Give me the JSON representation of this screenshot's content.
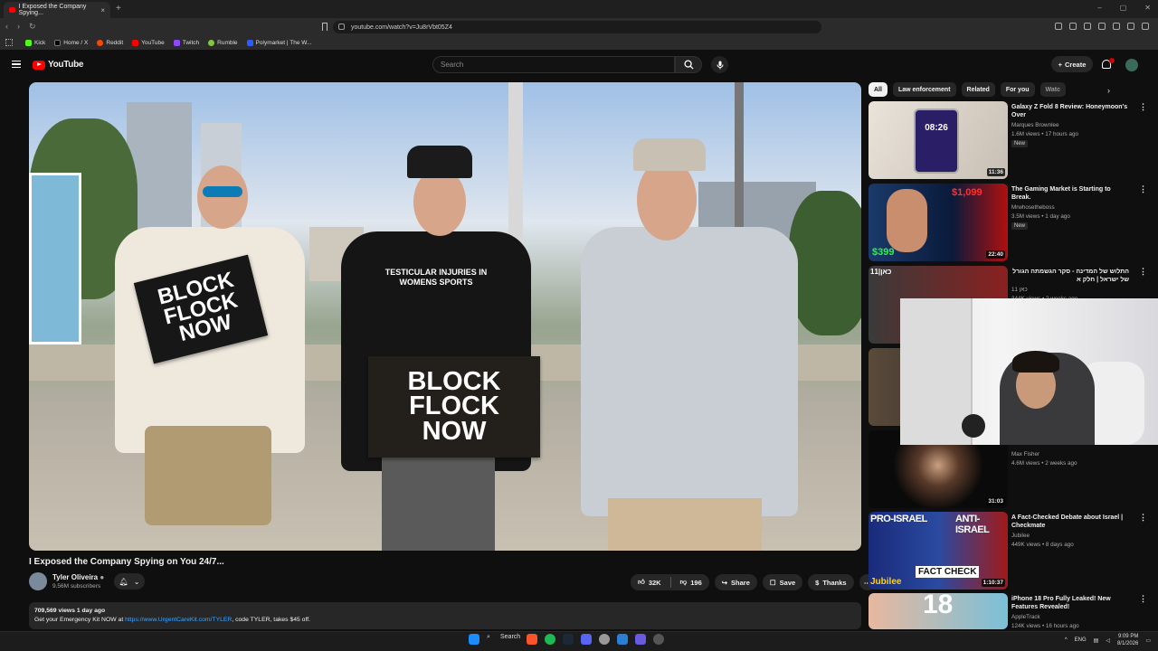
{
  "browser": {
    "tab_title": "I Exposed the Company Spying...",
    "url": "youtube.com/watch?v=Ju8rVbt05Z4",
    "bookmarks": [
      "Kick",
      "Home / X",
      "Reddit",
      "YouTube",
      "Twitch",
      "Rumble",
      "Polymarket | The W..."
    ]
  },
  "youtube": {
    "logo": "YouTube",
    "search_placeholder": "Search",
    "create_label": "Create",
    "notification_count": "1"
  },
  "video": {
    "sign_text": [
      "BLOCK",
      "FLOCK",
      "NOW"
    ],
    "shirt_text": "TESTICULAR INJURIES IN WOMENS SPORTS",
    "title": "I Exposed the Company Spying on You 24/7...",
    "channel": "Tyler Oliveira",
    "subscribers": "9.56M subscribers",
    "likes": "32K",
    "dislikes": "196",
    "share_label": "Share",
    "save_label": "Save",
    "thanks_label": "Thanks",
    "views_date": "709,569 views  1 day ago",
    "desc_prefix": "Get your Emergency Kit NOW at ",
    "desc_link": "https://www.UrgentCareKit.com/TYLER",
    "desc_suffix": ", code TYLER, takes $45 off."
  },
  "chips": [
    "All",
    "Law enforcement",
    "Related",
    "For you",
    "Watc"
  ],
  "recommendations": [
    {
      "title": "Galaxy Z Fold 8 Review: Honeymoon's Over",
      "channel": "Marques Brownlee",
      "meta": "1.6M views • 17 hours ago",
      "badge": "New",
      "duration": "11:36",
      "thumb_text": "08:26"
    },
    {
      "title": "The Gaming Market is Starting to Break.",
      "channel": "Mrwhosetheboss",
      "meta": "3.5M views • 1 day ago",
      "badge": "New",
      "duration": "22:40",
      "thumb_text": "$1,099",
      "thumb_text2": "$399"
    },
    {
      "title": "התלוש של המדינה - סקר הגשמתה הגורל של ישראל | חלק א",
      "channel": "כאן 11",
      "meta": "344K views • 2 weeks ago",
      "badge": "",
      "duration": "",
      "thumb_text": "11|כאן"
    },
    {
      "title": "",
      "channel": "",
      "meta": "",
      "badge": "",
      "duration": "",
      "thumb_text": ""
    },
    {
      "title": "",
      "channel": "Max Fisher",
      "meta": "4.6M views • 2 weeks ago",
      "badge": "",
      "duration": "31:03",
      "thumb_text": ""
    },
    {
      "title": "A Fact-Checked Debate about Israel | Checkmate",
      "channel": "Jubilee",
      "meta": "449K views • 8 days ago",
      "badge": "",
      "duration": "1:10:37",
      "thumb_text": "PRO-ISRAEL",
      "thumb_text2": "ANTI-ISRAEL",
      "thumb_text3": "FACT CHECK",
      "thumb_text4": "Jubilee"
    },
    {
      "title": "iPhone 18 Pro Fully Leaked! New Features Revealed!",
      "channel": "AppleTrack",
      "meta": "124K views • 16 hours ago",
      "badge": "",
      "duration": "",
      "thumb_text": "18"
    }
  ],
  "taskbar": {
    "search_label": "Search",
    "lang": "ENG",
    "time": "9:09 PM",
    "date": "8/1/2026"
  },
  "colors": {
    "accent": "#ff0000",
    "link": "#3ea6ff",
    "bg": "#0f0f0f",
    "surface": "#272727"
  }
}
